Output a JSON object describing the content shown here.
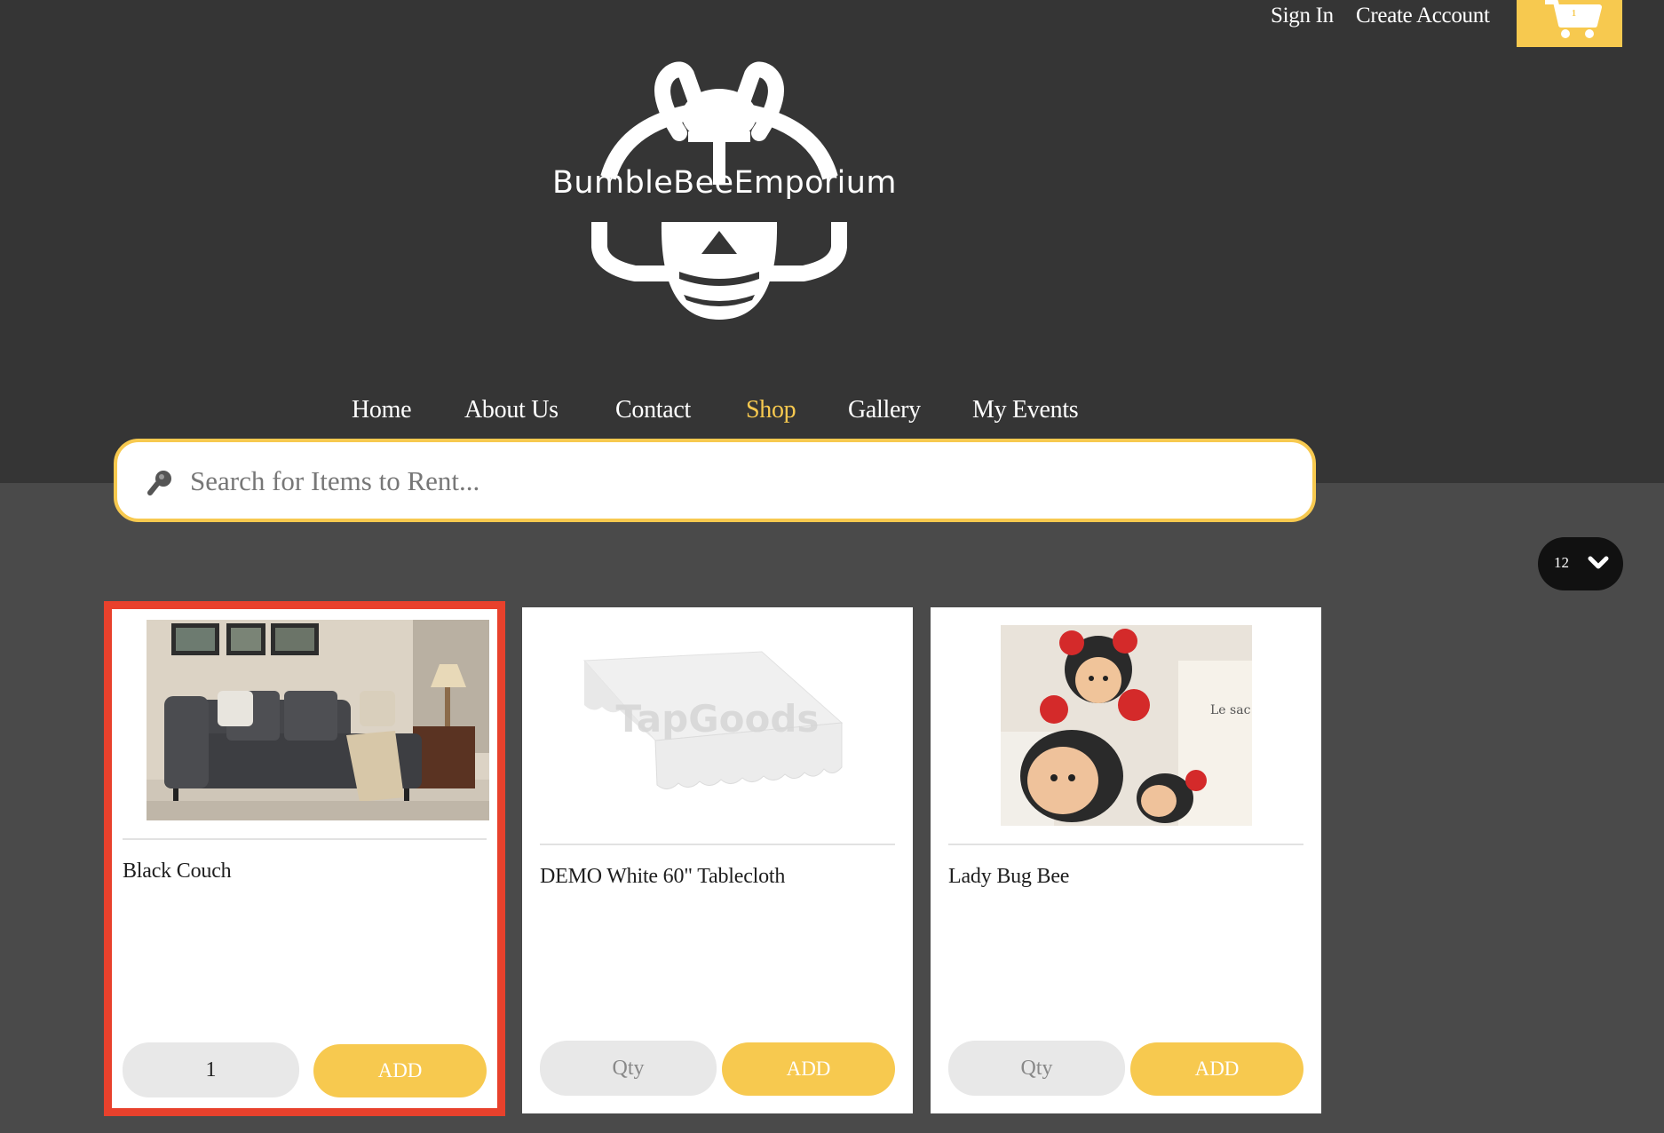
{
  "account": {
    "sign_in": "Sign In",
    "create_account": "Create Account"
  },
  "cart": {
    "count": "1"
  },
  "brand": {
    "name": "BumbleBeeEmporium"
  },
  "nav": {
    "items": [
      {
        "label": "Home"
      },
      {
        "label": "About Us"
      },
      {
        "label": "Contact"
      },
      {
        "label": "Shop",
        "active": true
      },
      {
        "label": "Gallery"
      },
      {
        "label": "My Events"
      }
    ]
  },
  "search": {
    "placeholder": "Search for Items to Rent..."
  },
  "per_page": {
    "value": "12"
  },
  "products": [
    {
      "title": "Black Couch",
      "qty_value": "1",
      "qty_placeholder": "Qty",
      "add_label": "ADD"
    },
    {
      "title": "DEMO White 60\" Tablecloth",
      "qty_value": "",
      "qty_placeholder": "Qty",
      "add_label": "ADD",
      "image_watermark": "TapGoods"
    },
    {
      "title": "Lady Bug Bee",
      "qty_value": "",
      "qty_placeholder": "Qty",
      "add_label": "ADD",
      "image_note": "Le sac"
    }
  ],
  "colors": {
    "accent": "#f7c94f",
    "header_bg": "#353535",
    "page_bg": "#4a4a4a",
    "selection": "#e8412c"
  }
}
